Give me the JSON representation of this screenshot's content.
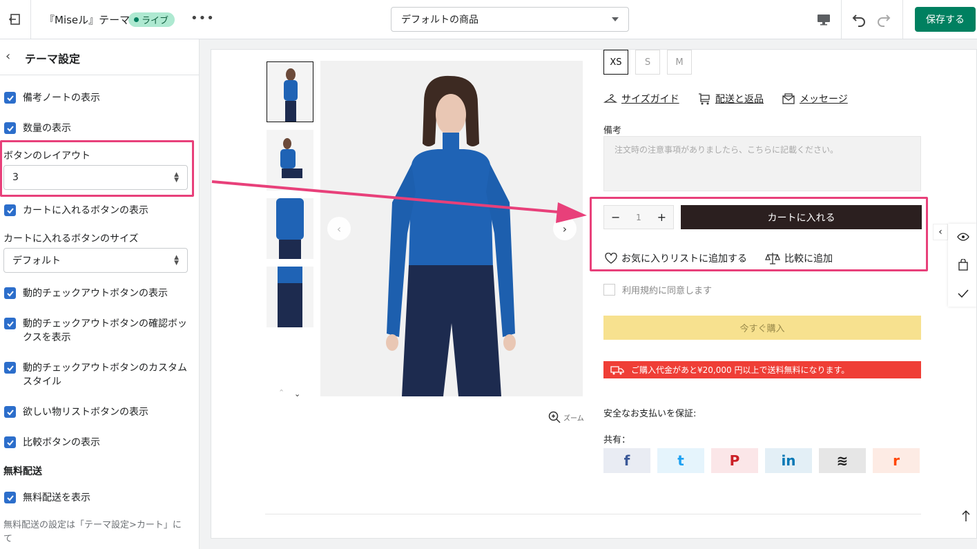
{
  "topbar": {
    "theme_title": "『Miseル』テーマ",
    "live_badge": "ライブ",
    "more": "•••",
    "template_select": "デフォルトの商品",
    "save_label": "保存する"
  },
  "sidebar": {
    "title": "テーマ設定",
    "items": [
      {
        "label": "備考ノートの表示"
      },
      {
        "label": "数量の表示"
      }
    ],
    "button_layout": {
      "label": "ボタンのレイアウト",
      "value": "3"
    },
    "cart_button_display": "カートに入れるボタンの表示",
    "cart_button_size": {
      "label": "カートに入れるボタンのサイズ",
      "value": "デフォルト"
    },
    "dynamic_checkout": "動的チェックアウトボタンの表示",
    "dynamic_checkout_confirm": "動的チェックアウトボタンの確認ボックスを表示",
    "dynamic_checkout_custom": "動的チェックアウトボタンのカスタムスタイル",
    "wishlist_button": "欲しい物リストボタンの表示",
    "compare_button": "比較ボタンの表示",
    "free_shipping_section": "無料配送",
    "free_shipping_display": "無料配送を表示",
    "free_shipping_note": "無料配送の設定は「テーマ設定>カート」にて"
  },
  "product": {
    "sizes": [
      "XS",
      "S",
      "M"
    ],
    "selected_size": "XS",
    "links": {
      "size_guide": "サイズガイド",
      "shipping": "配送と返品",
      "message": "メッセージ"
    },
    "note_label": "備考",
    "note_placeholder": "注文時の注意事項がありましたら、こちらに記載ください。",
    "qty_minus": "−",
    "qty_value": "1",
    "qty_plus": "+",
    "add_to_cart": "カートに入れる",
    "wishlist": "お気に入りリストに追加する",
    "compare": "比較に追加",
    "terms": "利用規約に同意します",
    "buy_now": "今すぐ購入",
    "free_shipping_bar": "ご購入代金があと¥20,000 円以上で送料無料になります。",
    "secure_payment": "安全なお支払いを保証:",
    "share_label": "共有：",
    "zoom": "ズーム",
    "share_buttons": [
      "f",
      "t",
      "P",
      "in",
      "≋",
      "r"
    ]
  },
  "colors": {
    "accent_green": "#008060",
    "highlight_pink": "#e8407a",
    "checkbox_blue": "#2c6ecb",
    "cart_dark": "#2b1f1f",
    "buy_now_yellow": "#f7e18f",
    "shipping_red": "#ef3e36"
  }
}
